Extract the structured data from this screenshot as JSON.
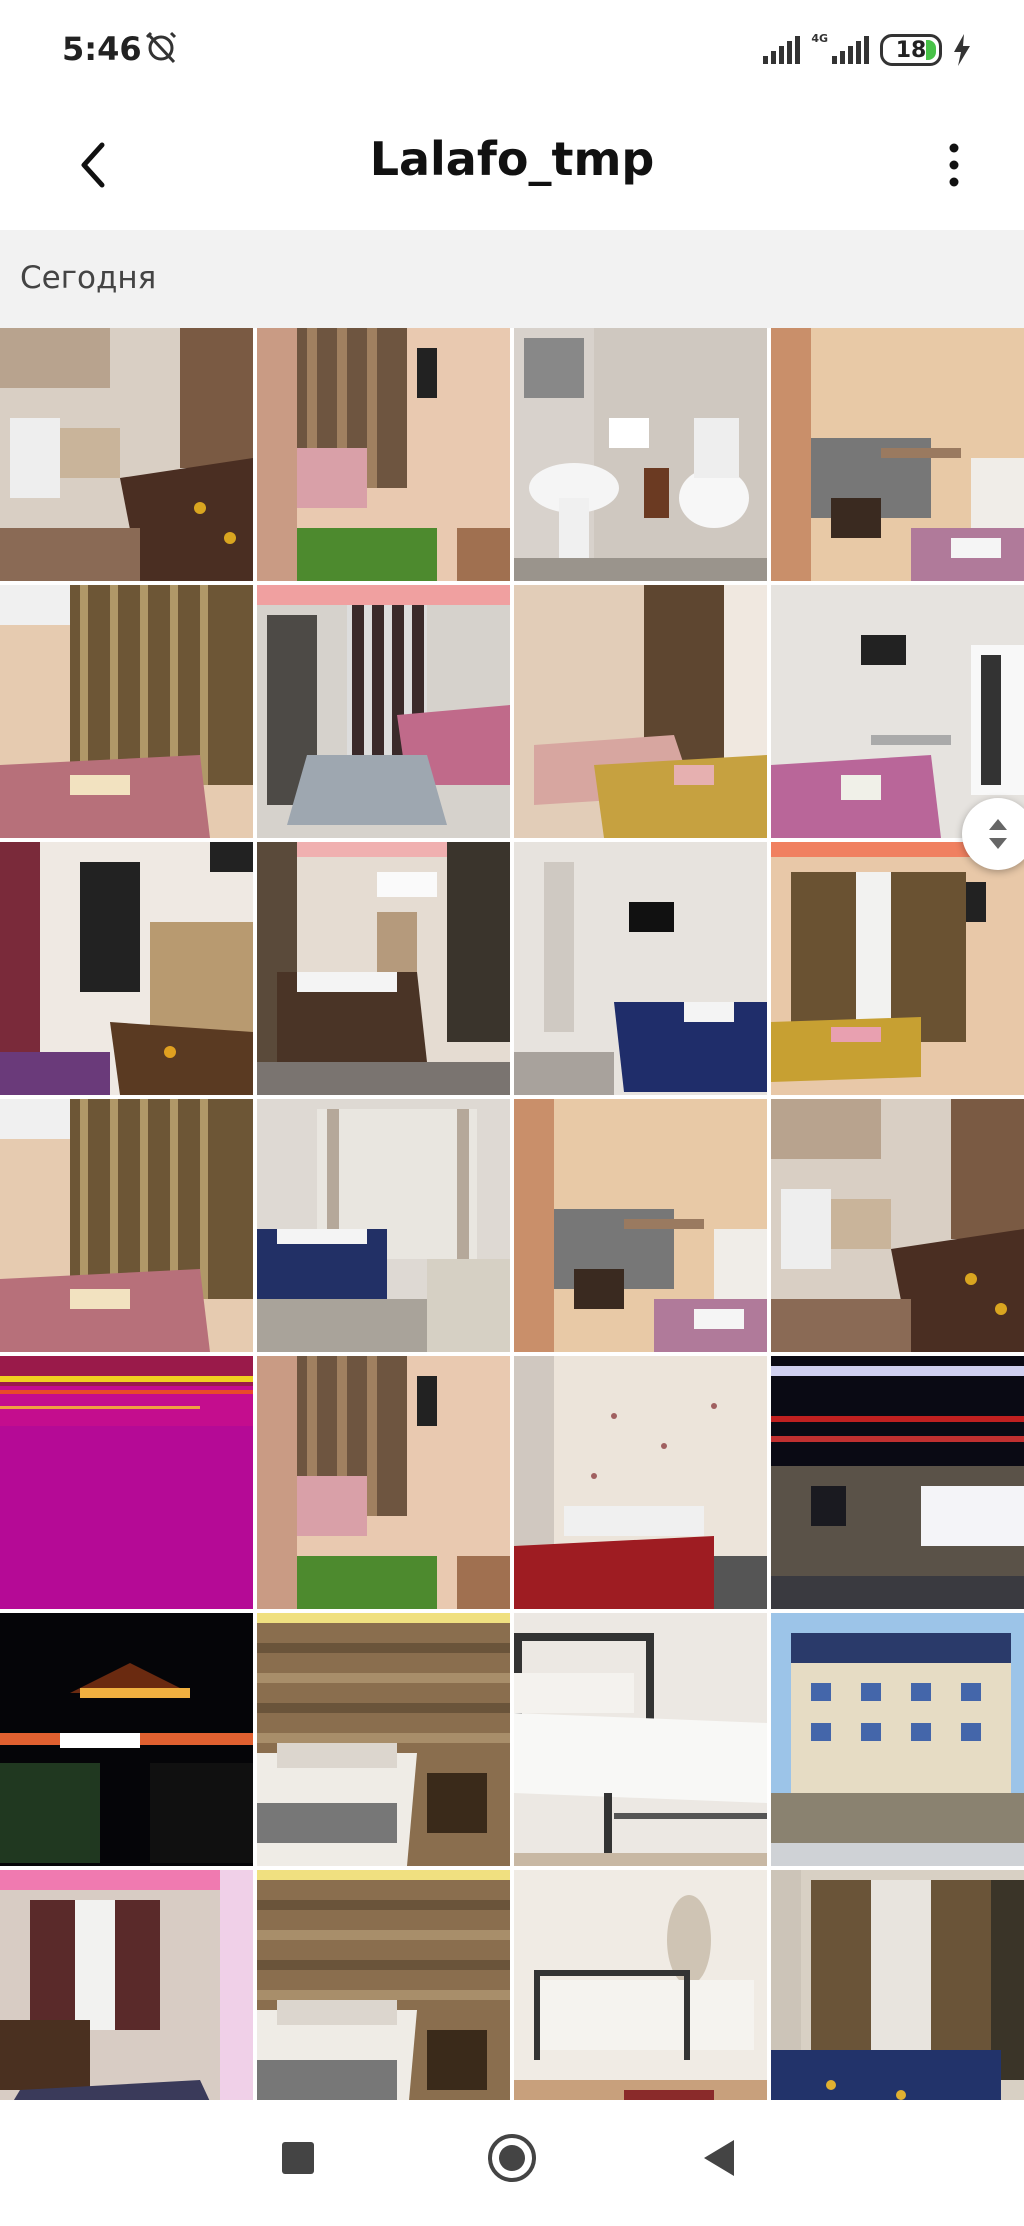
{
  "status_bar": {
    "time": "5:46",
    "network": "4G",
    "battery": "18"
  },
  "header": {
    "title": "Lalafo_tmp"
  },
  "section": {
    "label": "Сегодня"
  },
  "colors": {
    "accent_battery": "#48c248",
    "icon": "#444444"
  },
  "photos": [
    {
      "scene": "kitchenette-bed"
    },
    {
      "scene": "corridor-curtain"
    },
    {
      "scene": "bathroom"
    },
    {
      "scene": "room-desk"
    },
    {
      "scene": "curtain-bed-pink"
    },
    {
      "scene": "room-rug"
    },
    {
      "scene": "wallpaper-bed"
    },
    {
      "scene": "tv-room-pink"
    },
    {
      "scene": "door-room"
    },
    {
      "scene": "double-bed-lights"
    },
    {
      "scene": "blue-bed-tv"
    },
    {
      "scene": "curtain-room-yellow"
    },
    {
      "scene": "curtain-bed-pink"
    },
    {
      "scene": "blue-beds-window"
    },
    {
      "scene": "room-desk"
    },
    {
      "scene": "kitchenette-bed"
    },
    {
      "scene": "magenta-glitch"
    },
    {
      "scene": "corridor-curtain"
    },
    {
      "scene": "red-bed-wallpaper"
    },
    {
      "scene": "hotel-night"
    },
    {
      "scene": "hotel-sign-night"
    },
    {
      "scene": "wood-wall-bed"
    },
    {
      "scene": "white-bed-metal"
    },
    {
      "scene": "hotel-building-day"
    },
    {
      "scene": "pink-light-room"
    },
    {
      "scene": "wood-wall-bed"
    },
    {
      "scene": "iron-bed-mirror"
    },
    {
      "scene": "curtain-blue-bed"
    }
  ]
}
